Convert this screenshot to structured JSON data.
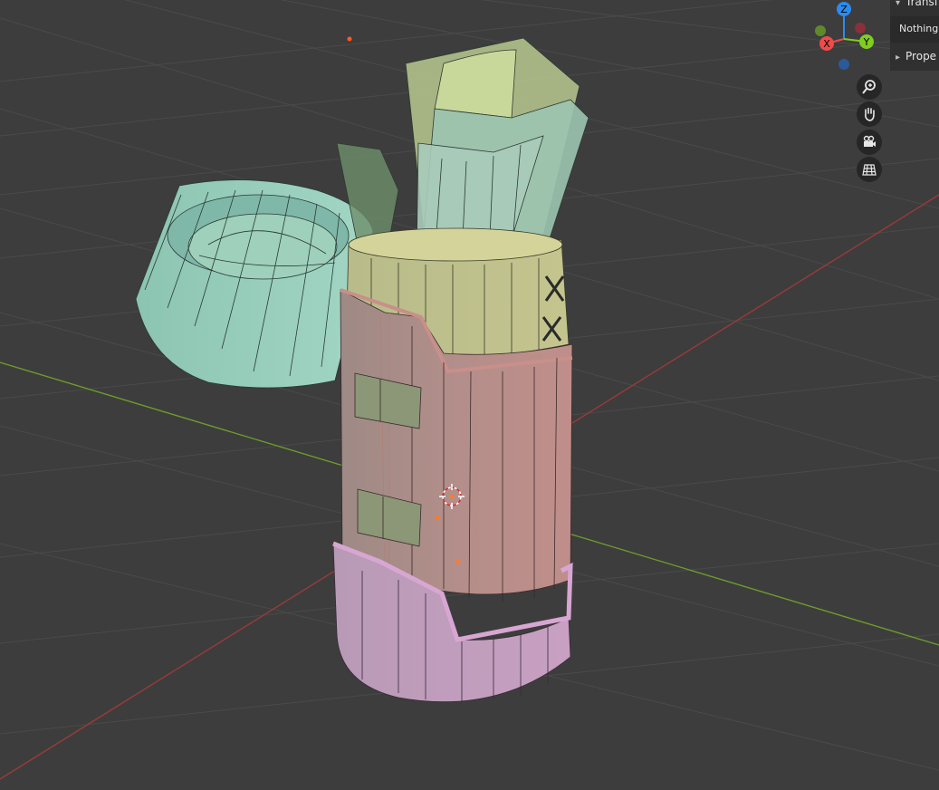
{
  "sidebar": {
    "transform_label": "Transf",
    "nothing_selected": "Nothing s",
    "properties_label": "Prope",
    "expanded_arrow": "▾",
    "collapsed_arrow": "▸"
  },
  "gizmo": {
    "z_label": "Z",
    "x_label": "X",
    "y_label": "Y",
    "colors": {
      "x": "#f04a4a",
      "y": "#7fcd1f",
      "z": "#2a8cf0"
    }
  },
  "nav_tools": {
    "zoom": "zoom-icon",
    "pan": "hand-icon",
    "camera": "camera-icon",
    "ortho": "grid-icon"
  },
  "scene": {
    "grid_color": "#4a4a4a",
    "x_axis_color": "#9a3a3a",
    "y_axis_color": "#6f9a2a"
  }
}
